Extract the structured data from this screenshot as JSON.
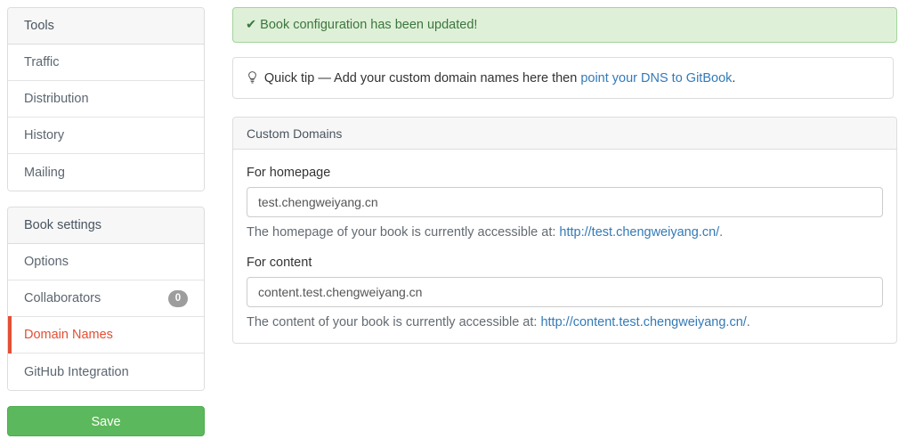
{
  "sidebar": {
    "panels": [
      {
        "title": "Tools",
        "items": [
          {
            "label": "Traffic"
          },
          {
            "label": "Distribution"
          },
          {
            "label": "History"
          },
          {
            "label": "Mailing"
          }
        ]
      },
      {
        "title": "Book settings",
        "items": [
          {
            "label": "Options"
          },
          {
            "label": "Collaborators",
            "badge": "0"
          },
          {
            "label": "Domain Names",
            "active": true
          },
          {
            "label": "GitHub Integration"
          }
        ]
      }
    ],
    "save_label": "Save"
  },
  "alert": {
    "icon": "check-icon",
    "check_glyph": "✔",
    "message": "Book configuration has been updated!"
  },
  "tip": {
    "icon": "lightbulb-icon",
    "bulb_glyph": "Ὂ1",
    "prefix": "Quick tip — Add your custom domain names here then ",
    "link_text": "point your DNS to GitBook",
    "suffix": "."
  },
  "panel": {
    "title": "Custom Domains",
    "fields": [
      {
        "label": "For homepage",
        "value": "test.chengweiyang.cn",
        "placeholder": "test.chengweiyang.cn",
        "help_prefix": "The homepage of your book is currently accessible at: ",
        "help_link": "http://test.chengweiyang.cn/",
        "help_suffix": "."
      },
      {
        "label": "For content",
        "value": "content.test.chengweiyang.cn",
        "placeholder": "content.test.chengweiyang.cn",
        "help_prefix": "The content of your book is currently accessible at: ",
        "help_link": "http://content.test.chengweiyang.cn/",
        "help_suffix": "."
      }
    ]
  },
  "colors": {
    "accent_red": "#e24f35",
    "link_blue": "#337ab7",
    "success_bg": "#dff0d8",
    "success_border": "#a3d39c",
    "success_text": "#3c763d",
    "save_green": "#5cb85c",
    "badge_gray": "#9d9d9d"
  }
}
